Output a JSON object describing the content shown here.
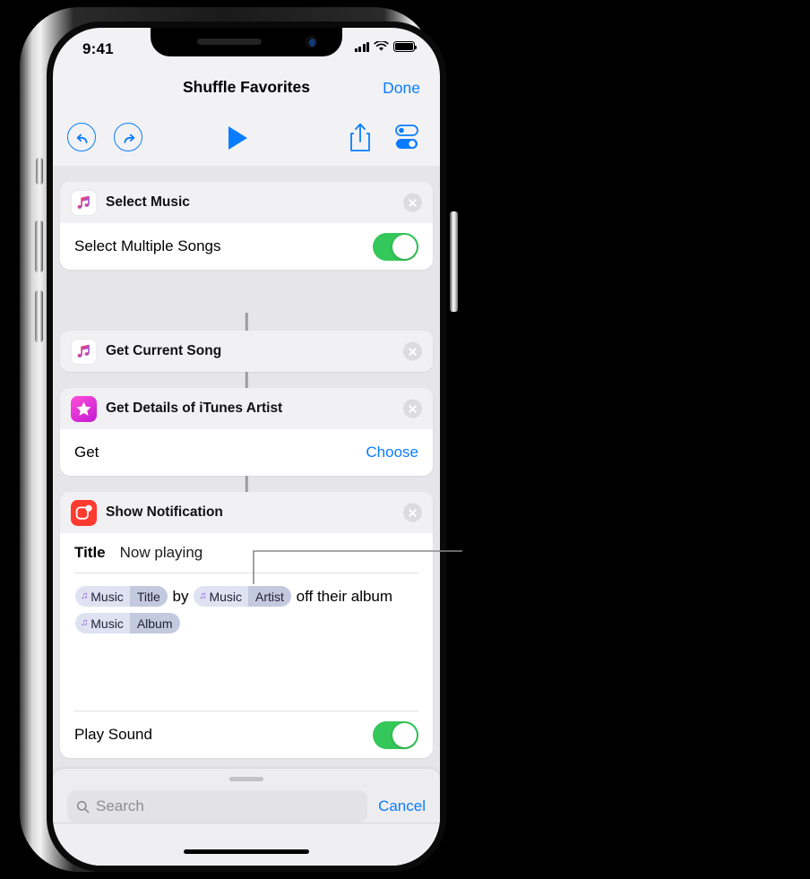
{
  "status_bar": {
    "time": "9:41",
    "signal_icon": "cellular-bars-icon",
    "wifi_icon": "wifi-icon",
    "battery_icon": "battery-icon"
  },
  "nav": {
    "title": "Shuffle Favorites",
    "done_label": "Done"
  },
  "toolbar": {
    "undo_icon": "undo-icon",
    "redo_icon": "redo-icon",
    "play_icon": "play-icon",
    "share_icon": "share-icon",
    "settings_icon": "settings-toggles-icon"
  },
  "actions": [
    {
      "icon": "music-app-icon",
      "title": "Select Music",
      "rows": [
        {
          "type": "toggle",
          "label": "Select Multiple Songs",
          "value": "on"
        }
      ]
    },
    {
      "icon": "music-app-icon",
      "title": "Get Current Song",
      "rows": []
    },
    {
      "icon": "itunes-star-icon",
      "title": "Get Details of iTunes Artist",
      "rows": [
        {
          "type": "choice",
          "label": "Get",
          "value": "Choose"
        }
      ]
    },
    {
      "icon": "notification-app-icon",
      "title": "Show Notification",
      "title_field": {
        "key": "Title",
        "value": "Now playing"
      },
      "message": {
        "tokens": [
          {
            "kind": "token",
            "source": "Music",
            "property": "Title",
            "icon": "music-note-icon"
          },
          {
            "kind": "text",
            "text": "by"
          },
          {
            "kind": "token",
            "source": "Music",
            "property": "Artist",
            "icon": "music-note-icon"
          },
          {
            "kind": "text",
            "text": "off their album"
          },
          {
            "kind": "token",
            "source": "Music",
            "property": "Album",
            "icon": "music-note-icon"
          }
        ]
      },
      "rows": [
        {
          "type": "toggle",
          "label": "Play Sound",
          "value": "on"
        }
      ]
    }
  ],
  "delete_button_label": "remove action",
  "sheet": {
    "grabber_icon": "sheet-grabber",
    "search_placeholder": "Search",
    "search_value": "",
    "search_icon": "search-icon",
    "cancel_label": "Cancel"
  },
  "colors": {
    "accent_blue": "#0a7cff",
    "toggle_green": "#34c759",
    "notification_red": "#ff3b30",
    "itunes_magenta": "#c21ad4",
    "token_fill": "#dfe2f0",
    "token_property_fill": "#c3c9de",
    "background": "#e6e6ea"
  }
}
